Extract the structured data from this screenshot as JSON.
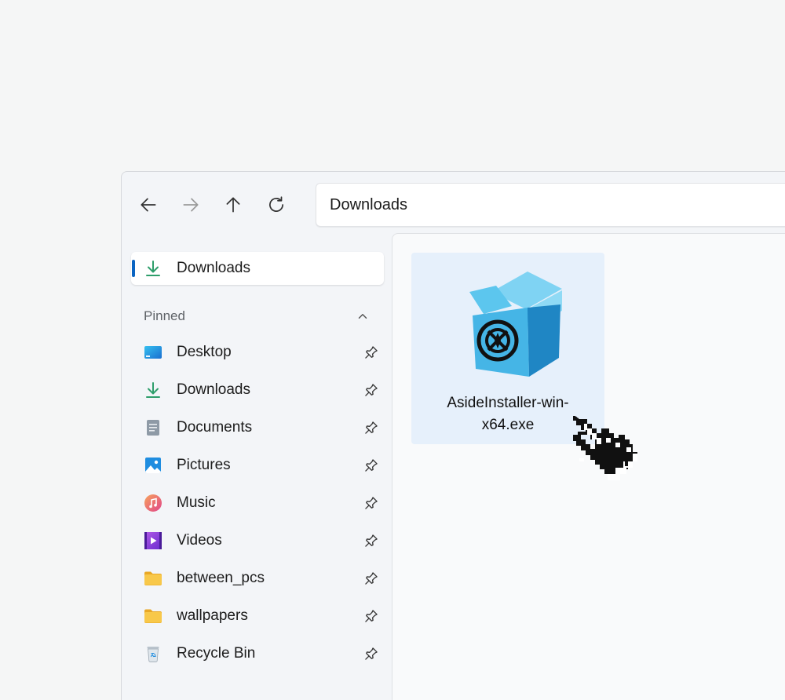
{
  "address": {
    "path": "Downloads"
  },
  "sidebar": {
    "top_item": {
      "label": "Downloads",
      "icon": "download-icon"
    },
    "section_title": "Pinned",
    "items": [
      {
        "label": "Desktop",
        "icon": "desktop-icon"
      },
      {
        "label": "Downloads",
        "icon": "download-icon"
      },
      {
        "label": "Documents",
        "icon": "document-icon"
      },
      {
        "label": "Pictures",
        "icon": "pictures-icon"
      },
      {
        "label": "Music",
        "icon": "music-icon"
      },
      {
        "label": "Videos",
        "icon": "video-icon"
      },
      {
        "label": "between_pcs",
        "icon": "folder-icon"
      },
      {
        "label": "wallpapers",
        "icon": "folder-icon"
      },
      {
        "label": "Recycle Bin",
        "icon": "recycle-bin-icon"
      }
    ]
  },
  "files": [
    {
      "name": "AsideInstaller-win-x64.exe",
      "icon": "installer-box-icon"
    }
  ],
  "colors": {
    "accent": "#0a64c2",
    "selection": "#e6f0fb",
    "download_green": "#2e9e6b",
    "folder_yellow": "#f5c042",
    "box_blue": "#4bbbe9"
  }
}
